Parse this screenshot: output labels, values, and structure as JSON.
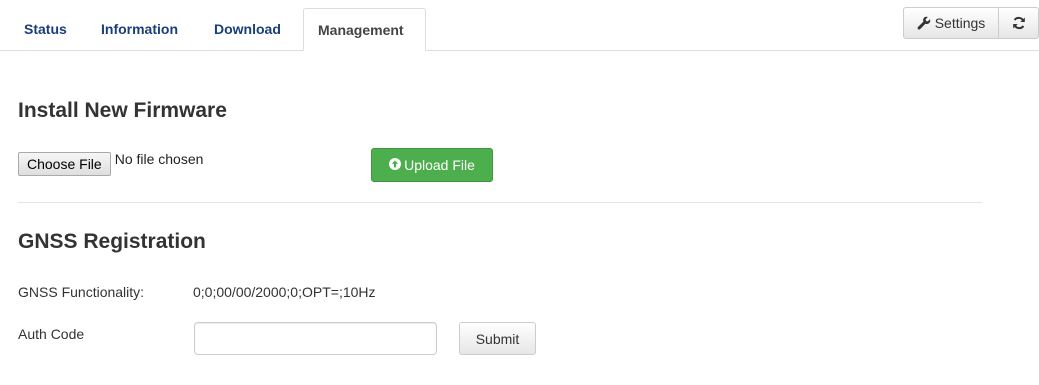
{
  "tabs": [
    {
      "label": "Status",
      "active": false
    },
    {
      "label": "Information",
      "active": false
    },
    {
      "label": "Download",
      "active": false
    },
    {
      "label": "Management",
      "active": true
    }
  ],
  "toolbar": {
    "settings_label": "Settings",
    "settings_icon": "wrench-icon",
    "refresh_icon": "refresh-icon"
  },
  "firmware": {
    "heading": "Install New Firmware",
    "choose_file_label": "Choose File",
    "file_status": "No file chosen",
    "upload_label": "Upload File",
    "upload_icon": "circle-arrow-up-icon"
  },
  "gnss": {
    "heading": "GNSS Registration",
    "functionality_label": "GNSS Functionality:",
    "functionality_value": "0;0;00/00/2000;0;OPT=;10Hz",
    "auth_code_label": "Auth Code",
    "auth_code_value": "",
    "submit_label": "Submit"
  },
  "colors": {
    "tab_link": "#1a3e7a",
    "success": "#4cae4c",
    "border": "#dddddd"
  }
}
